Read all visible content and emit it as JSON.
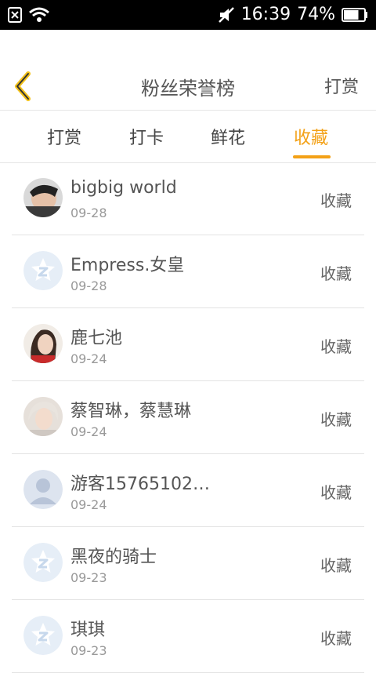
{
  "status": {
    "time": "16:39",
    "battery": "74%",
    "battery_level": 0.74
  },
  "header": {
    "title": "粉丝荣誉榜",
    "right_action": "打赏",
    "back_icon": "chevron-left-icon"
  },
  "tabs": [
    {
      "label": "打赏",
      "active": false
    },
    {
      "label": "打卡",
      "active": false
    },
    {
      "label": "鲜花",
      "active": false
    },
    {
      "label": "收藏",
      "active": true
    }
  ],
  "rows": [
    {
      "name": "bigbig world",
      "date": "09-28",
      "action": "收藏",
      "avatar": "photo-avatar-man"
    },
    {
      "name": "Empress.女皇",
      "date": "09-28",
      "action": "收藏",
      "avatar": "default-z-avatar"
    },
    {
      "name": "鹿七池",
      "date": "09-24",
      "action": "收藏",
      "avatar": "photo-avatar-woman"
    },
    {
      "name": "蔡智琳，蔡慧琳",
      "date": "09-24",
      "action": "收藏",
      "avatar": "photo-avatar-person"
    },
    {
      "name": "游客15765102…",
      "date": "09-24",
      "action": "收藏",
      "avatar": "guest-avatar"
    },
    {
      "name": "黑夜的骑士",
      "date": "09-23",
      "action": "收藏",
      "avatar": "default-z-avatar"
    },
    {
      "name": "琪琪",
      "date": "09-23",
      "action": "收藏",
      "avatar": "default-z-avatar"
    }
  ],
  "colors": {
    "accent": "#f3a117",
    "text": "#555555",
    "subtext": "#999999"
  }
}
